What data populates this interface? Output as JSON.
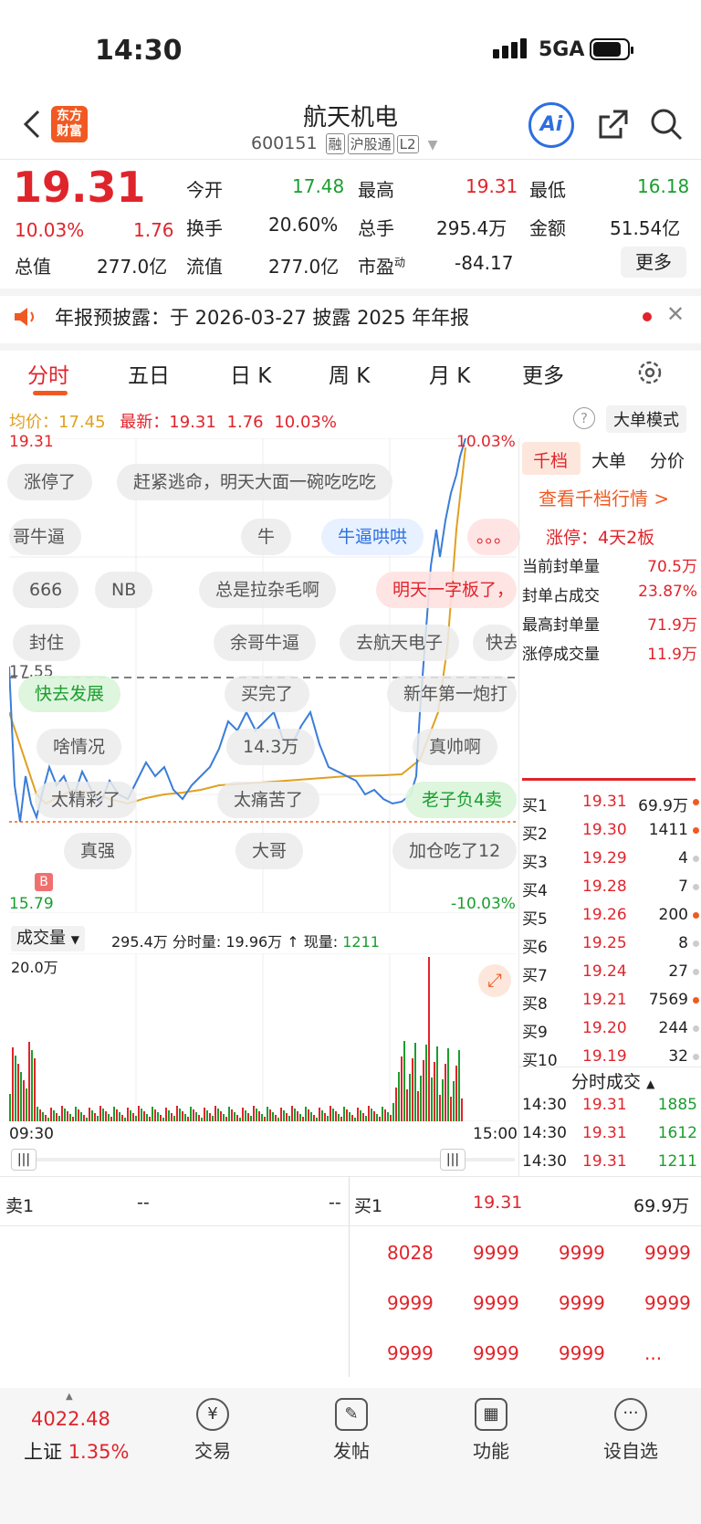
{
  "status": {
    "time": "14:30",
    "network": "5GA"
  },
  "header": {
    "title": "航天机电",
    "code": "600151",
    "tags": [
      "融",
      "沪股通",
      "L2"
    ],
    "logo": "东方\n财富",
    "ai_label": "Ai"
  },
  "quote": {
    "price": "19.31",
    "pct": "10.03%",
    "change": "1.76",
    "open_label": "今开",
    "open": "17.48",
    "high_label": "最高",
    "high": "19.31",
    "low_label": "最低",
    "low": "16.18",
    "turnover_label": "换手",
    "turnover": "20.60%",
    "volume_label": "总手",
    "volume": "295.4万",
    "amount_label": "金额",
    "amount": "51.54亿",
    "mktcap_label": "总值",
    "mktcap": "277.0亿",
    "float_label": "流值",
    "float": "277.0亿",
    "pe_label": "市盈",
    "pe_sup": "动",
    "pe": "-84.17",
    "more": "更多"
  },
  "notice": {
    "text": "年报预披露：于 2026-03-27 披露 2025 年年报"
  },
  "tabs": [
    "分时",
    "五日",
    "日 K",
    "周 K",
    "月 K",
    "更多"
  ],
  "avgline": {
    "avg_label": "均价：",
    "avg": "17.45",
    "latest_label": "最新：",
    "latest": "19.31",
    "chg": "1.76",
    "pct": "10.03%",
    "mode": "大单模式"
  },
  "chart": {
    "top_price": "19.31",
    "top_pct": "10.03%",
    "mid_price": "17.55",
    "low_price": "15.79",
    "low_pct": "-10.03%",
    "b_marker": "B",
    "vol_selector": "成交量",
    "vol_info": "295.4万 分时量: 19.96万 ↑ 现量: ",
    "vol_now": "1211",
    "vol_max": "20.0万",
    "t_start": "09:30",
    "t_end": "15:00",
    "bubbles": [
      "涨停了",
      "赶紧逃命，明天大面一碗吃吃吃",
      "哥牛逼",
      "牛",
      "牛逼哄哄",
      "。。。",
      "666",
      "NB",
      "总是拉杂毛啊",
      "明天一字板了，",
      "封住",
      "余哥牛逼",
      "去航天电子",
      "快去",
      "快去发展",
      "买完了",
      "新年第一炮打",
      "啥情况",
      "14.3万",
      "真帅啊",
      "太精彩了",
      "太痛苦了",
      "老子负4卖",
      "真强",
      "大哥",
      "加仓吃了12"
    ]
  },
  "side_tabs": [
    "千档",
    "大单",
    "分价"
  ],
  "side": {
    "link": "查看千档行情 >",
    "limit_label": "涨停：4天2板",
    "rows": [
      {
        "label": "当前封单量",
        "value": "70.5万"
      },
      {
        "label": "封单占成交",
        "value": "23.87%"
      },
      {
        "label": "最高封单量",
        "value": "71.9万"
      },
      {
        "label": "涨停成交量",
        "value": "11.9万"
      }
    ],
    "bids": [
      {
        "name": "买1",
        "price": "19.31",
        "vol": "69.9万"
      },
      {
        "name": "买2",
        "price": "19.30",
        "vol": "1411"
      },
      {
        "name": "买3",
        "price": "19.29",
        "vol": "4"
      },
      {
        "name": "买4",
        "price": "19.28",
        "vol": "7"
      },
      {
        "name": "买5",
        "price": "19.26",
        "vol": "200"
      },
      {
        "name": "买6",
        "price": "19.25",
        "vol": "8"
      },
      {
        "name": "买7",
        "price": "19.24",
        "vol": "27"
      },
      {
        "name": "买8",
        "price": "19.21",
        "vol": "7569"
      },
      {
        "name": "买9",
        "price": "19.20",
        "vol": "244"
      },
      {
        "name": "买10",
        "price": "19.19",
        "vol": "32"
      }
    ],
    "ticks_title": "分时成交",
    "ticks": [
      {
        "t": "14:30",
        "p": "19.31",
        "v": "1885"
      },
      {
        "t": "14:30",
        "p": "19.31",
        "v": "1612"
      },
      {
        "t": "14:30",
        "p": "19.31",
        "v": "1211"
      }
    ]
  },
  "queue": {
    "sell_label": "卖1",
    "sell_p": "--",
    "sell_v": "--",
    "buy_label": "买1",
    "buy_p": "19.31",
    "buy_v": "69.9万",
    "orders": [
      "8028",
      "9999",
      "9999",
      "9999",
      "9999",
      "9999",
      "9999",
      "9999",
      "9999",
      "9999",
      "9999",
      "..."
    ]
  },
  "nav": {
    "index_value": "4022.48",
    "index_name": "上证",
    "index_pct": "1.35%",
    "items": [
      "交易",
      "发帖",
      "功能",
      "设自选"
    ]
  }
}
